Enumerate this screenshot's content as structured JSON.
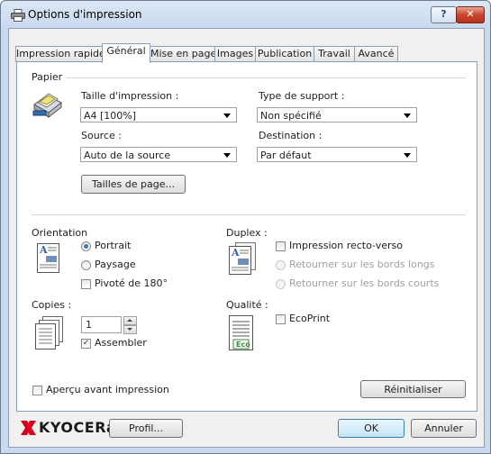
{
  "window": {
    "title": "Options d'impression",
    "help_label": "?",
    "close_label": "✕"
  },
  "tabs": [
    {
      "label": "Impression rapide"
    },
    {
      "label": "Général"
    },
    {
      "label": "Mise en page"
    },
    {
      "label": "Images"
    },
    {
      "label": "Publication"
    },
    {
      "label": "Travail"
    },
    {
      "label": "Avancé"
    }
  ],
  "active_tab": "Général",
  "paper": {
    "group_label": "Papier",
    "print_size": {
      "label": "Taille d'impression :",
      "value": "A4  [100%]"
    },
    "media_type": {
      "label": "Type de support :",
      "value": "Non spécifié"
    },
    "source": {
      "label": "Source :",
      "value": "Auto de la source"
    },
    "destination": {
      "label": "Destination :",
      "value": "Par défaut"
    },
    "page_sizes_button": "Tailles de page..."
  },
  "orientation": {
    "group_label": "Orientation",
    "options": [
      {
        "label": "Portrait",
        "checked": true
      },
      {
        "label": "Paysage",
        "checked": false
      }
    ],
    "rotate": {
      "label": "Pivoté de 180°",
      "checked": false
    }
  },
  "duplex": {
    "group_label": "Duplex :",
    "enable": {
      "label": "Impression recto-verso",
      "checked": false
    },
    "options": [
      {
        "label": "Retourner sur les bords longs",
        "enabled": false
      },
      {
        "label": "Retourner sur les bords courts",
        "enabled": false
      }
    ]
  },
  "copies": {
    "group_label": "Copies :",
    "value": "1",
    "collate": {
      "label": "Assembler",
      "checked": true
    }
  },
  "quality": {
    "group_label": "Qualité :",
    "ecoprint": {
      "label": "EcoPrint",
      "checked": false
    },
    "eco_badge": "Eco"
  },
  "preview": {
    "label": "Aperçu avant impression",
    "checked": false
  },
  "reset_button": "Réinitialiser",
  "footer": {
    "brand": "KYOCERa",
    "profile_button": "Profil...",
    "ok_button": "OK",
    "cancel_button": "Annuler"
  },
  "colors": {
    "brand_red": "#d6001c",
    "accent_blue": "#2e78c8"
  }
}
